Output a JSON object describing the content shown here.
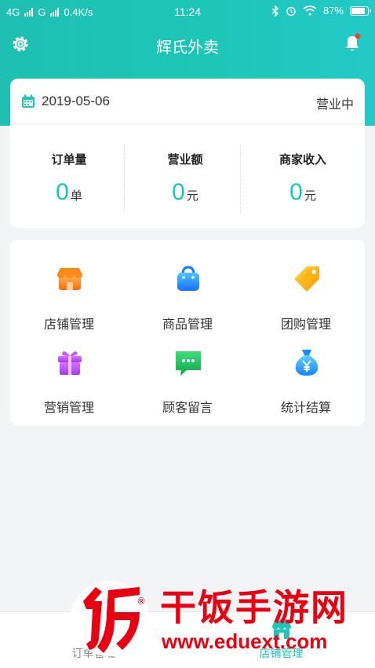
{
  "status_bar": {
    "network1": "4G",
    "network2": "G",
    "speed": "0.4K/s",
    "time": "11:24",
    "battery": "87%"
  },
  "header": {
    "title": "辉氏外卖",
    "settings_icon": "gear-icon",
    "notifications_icon": "bell-icon",
    "has_unread": true
  },
  "status_card": {
    "date": "2019-05-06",
    "business_status": "营业中",
    "stats": [
      {
        "label": "订单量",
        "value": "0",
        "unit": "单"
      },
      {
        "label": "营业额",
        "value": "0",
        "unit": "元"
      },
      {
        "label": "商家收入",
        "value": "0",
        "unit": "元"
      }
    ]
  },
  "menu": [
    {
      "label": "店铺管理",
      "icon": "store-icon",
      "color": "#ff7a1a"
    },
    {
      "label": "商品管理",
      "icon": "bag-icon",
      "color": "#1a8cff"
    },
    {
      "label": "团购管理",
      "icon": "tag-icon",
      "color": "#ffb300"
    },
    {
      "label": "营销管理",
      "icon": "gift-icon",
      "color": "#b04dff"
    },
    {
      "label": "顾客留言",
      "icon": "message-icon",
      "color": "#17c75a"
    },
    {
      "label": "统计结算",
      "icon": "money-bag-icon",
      "color": "#17a9ff"
    }
  ],
  "tabbar": [
    {
      "label": "订单管理",
      "icon": "order-icon",
      "active": false
    },
    {
      "label": "店铺管理",
      "icon": "store-icon",
      "active": true
    }
  ],
  "colors": {
    "accent": "#1ec6b7",
    "inactive": "#888888"
  },
  "watermark": {
    "seal_char": "饭",
    "registered_mark": "®",
    "title": "干饭手游网",
    "url": "www.eduext.com"
  }
}
